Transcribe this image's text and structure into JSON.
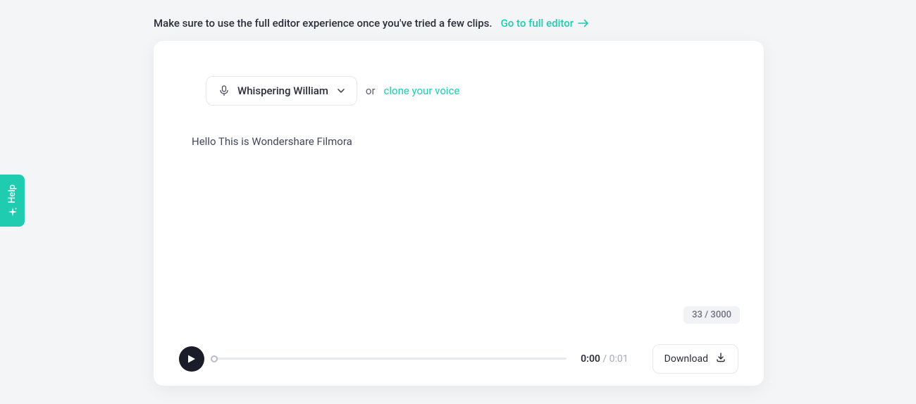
{
  "banner": {
    "text": "Make sure to use the full editor experience once you've tried a few clips.",
    "link_label": "Go to full editor"
  },
  "voice": {
    "selected_name": "Whispering William",
    "or_label": "or",
    "clone_link_label": "clone your voice"
  },
  "editor": {
    "text_content": "Hello This is Wondershare Filmora",
    "char_counter": "33 / 3000"
  },
  "player": {
    "current_time": "0:00",
    "total_time": "/ 0:01",
    "download_label": "Download"
  },
  "help": {
    "label": "Help"
  }
}
